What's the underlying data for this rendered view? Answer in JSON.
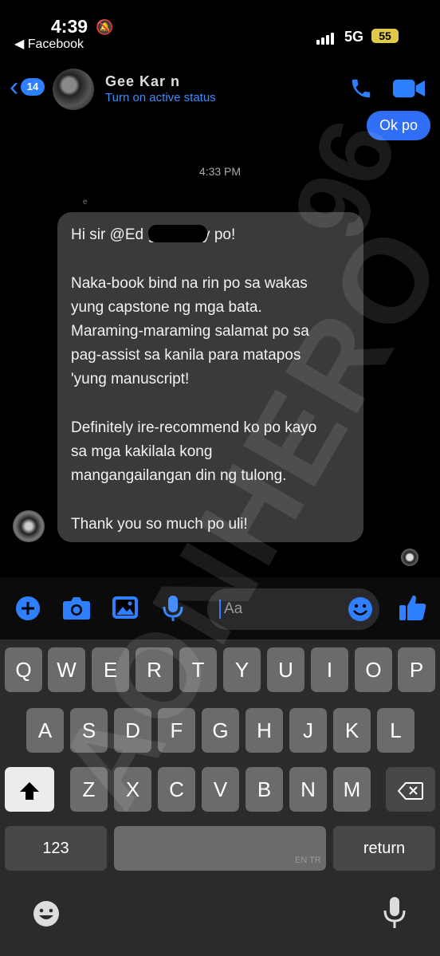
{
  "status_bar": {
    "time": "4:39",
    "back_app": "◀ Facebook",
    "network": "5G",
    "battery": "55"
  },
  "header": {
    "back_count": "14",
    "name": "Gee Kar n",
    "status": "Turn on active status"
  },
  "messages": {
    "sent": "Ok po",
    "timestamp": "4:33 PM",
    "sender_hint": "e",
    "received_lines": [
      "Hi sir @Ed              good day po!",
      "Naka-book bind na rin po sa wakas",
      "yung capstone ng mga bata.",
      "Maraming-maraming salamat po sa",
      "pag-assist sa kanila para matapos",
      "'yung manuscript!",
      "Definitely ire-recommend ko po kayo",
      "sa mga kakilala kong",
      "mangangailangan din ng tulong.",
      "Thank you so much po uli!"
    ]
  },
  "composer": {
    "placeholder": "Aa"
  },
  "keyboard": {
    "row1": [
      "Q",
      "W",
      "E",
      "R",
      "T",
      "Y",
      "U",
      "I",
      "O",
      "P"
    ],
    "row2": [
      "A",
      "S",
      "D",
      "F",
      "G",
      "H",
      "J",
      "K",
      "L"
    ],
    "row3": [
      "Z",
      "X",
      "C",
      "V",
      "B",
      "N",
      "M"
    ],
    "numbers_key": "123",
    "return_key": "return",
    "lang_hint": "EN TR"
  },
  "watermark": "AONHERO",
  "watermark2": "96",
  "colors": {
    "accent": "#2f80ff",
    "bubble": "#3a3a3c",
    "keyboard_bg": "#2b2b2d"
  }
}
